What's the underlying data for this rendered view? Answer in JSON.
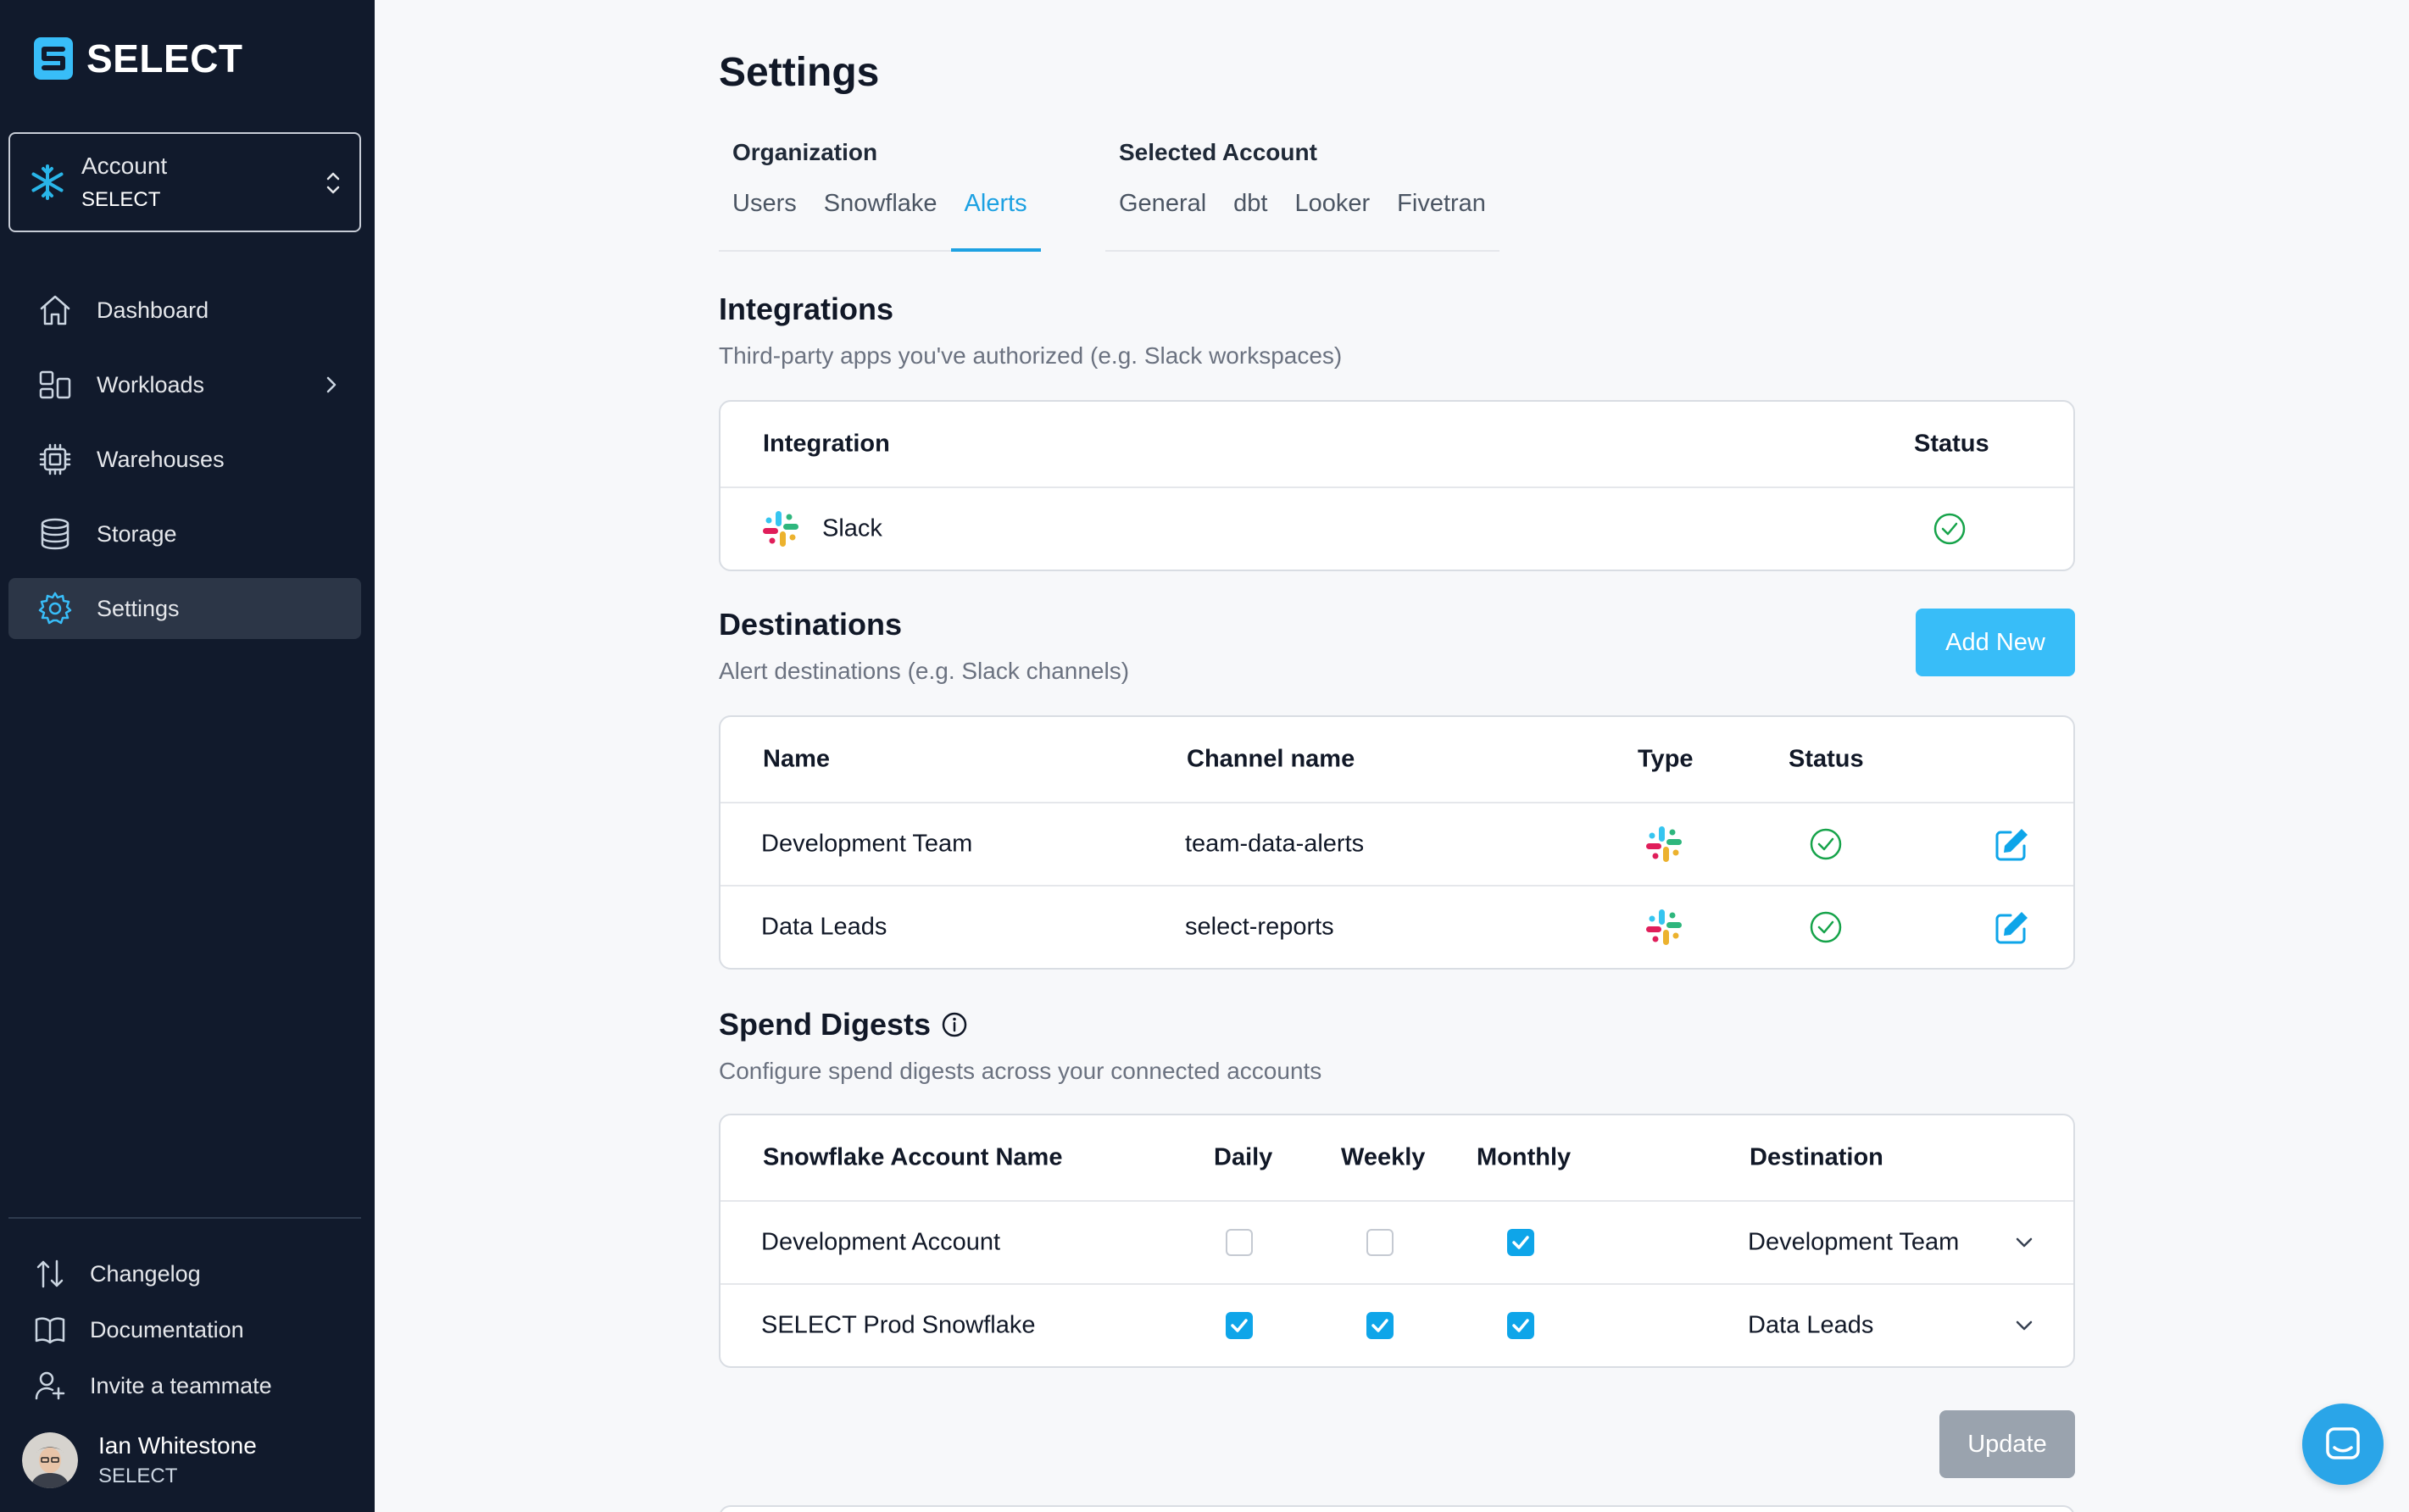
{
  "brand": {
    "name": "SELECT"
  },
  "account": {
    "label": "Account",
    "value": "SELECT"
  },
  "nav": {
    "items": [
      {
        "label": "Dashboard",
        "icon": "home-icon"
      },
      {
        "label": "Workloads",
        "icon": "workloads-icon"
      },
      {
        "label": "Warehouses",
        "icon": "chip-icon"
      },
      {
        "label": "Storage",
        "icon": "database-icon"
      },
      {
        "label": "Settings",
        "icon": "gear-icon",
        "active": true
      }
    ]
  },
  "bottom_links": [
    {
      "label": "Changelog",
      "icon": "arrows-updown-icon"
    },
    {
      "label": "Documentation",
      "icon": "book-icon"
    },
    {
      "label": "Invite a teammate",
      "icon": "user-plus-icon"
    }
  ],
  "user": {
    "name": "Ian Whitestone",
    "org": "SELECT"
  },
  "page": {
    "title": "Settings"
  },
  "tabs": {
    "organization": {
      "label": "Organization",
      "items": [
        "Users",
        "Snowflake",
        "Alerts"
      ],
      "active": "Alerts"
    },
    "selected_account": {
      "label": "Selected Account",
      "items": [
        "General",
        "dbt",
        "Looker",
        "Fivetran"
      ]
    }
  },
  "integrations": {
    "title": "Integrations",
    "subtitle": "Third-party apps you've authorized (e.g. Slack workspaces)",
    "headers": {
      "integration": "Integration",
      "status": "Status"
    },
    "rows": [
      {
        "name": "Slack",
        "status": "connected"
      }
    ]
  },
  "destinations": {
    "title": "Destinations",
    "subtitle": "Alert destinations (e.g. Slack channels)",
    "add_label": "Add New",
    "headers": {
      "name": "Name",
      "channel": "Channel name",
      "type": "Type",
      "status": "Status"
    },
    "rows": [
      {
        "name": "Development Team",
        "channel": "team-data-alerts"
      },
      {
        "name": "Data Leads",
        "channel": "select-reports"
      }
    ]
  },
  "digests": {
    "title": "Spend Digests",
    "subtitle": "Configure spend digests across your connected accounts",
    "headers": {
      "account": "Snowflake Account Name",
      "daily": "Daily",
      "weekly": "Weekly",
      "monthly": "Monthly",
      "destination": "Destination"
    },
    "rows": [
      {
        "account": "Development Account",
        "daily": false,
        "weekly": false,
        "monthly": true,
        "destination": "Development Team"
      },
      {
        "account": "SELECT Prod Snowflake",
        "daily": true,
        "weekly": true,
        "monthly": true,
        "destination": "Data Leads"
      }
    ],
    "update_label": "Update"
  },
  "colors": {
    "accent": "#1da1e2",
    "sidebar": "#111a2c",
    "success": "#16a34a",
    "button": "#38bdf8"
  }
}
